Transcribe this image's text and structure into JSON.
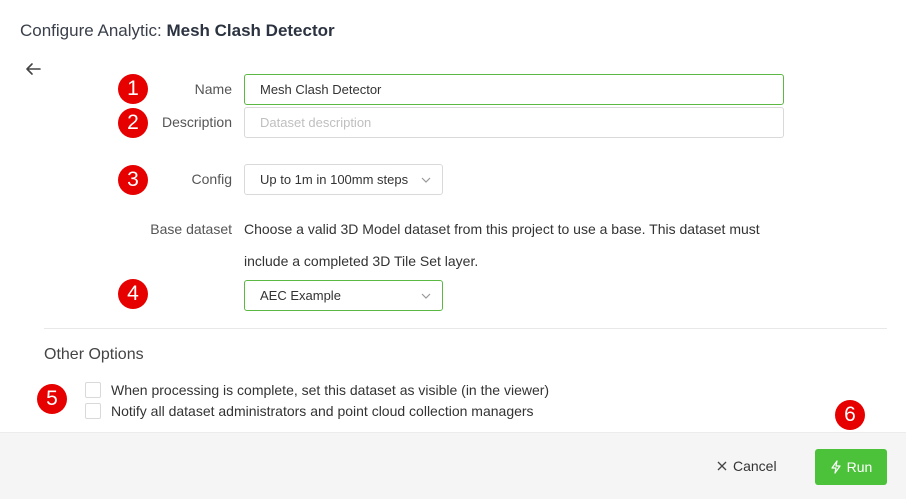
{
  "header": {
    "title_prefix": "Configure Analytic: ",
    "title_name": "Mesh Clash Detector"
  },
  "badges": [
    "1",
    "2",
    "3",
    "4",
    "5",
    "6"
  ],
  "form": {
    "name_label": "Name",
    "name_value": "Mesh Clash Detector",
    "description_label": "Description",
    "description_placeholder": "Dataset description",
    "config_label": "Config",
    "config_value": "Up to 1m in 100mm steps",
    "base_label": "Base dataset",
    "base_help_line1": "Choose a valid 3D Model dataset from this project to use a base. This dataset must",
    "base_help_line2": "include a completed 3D Tile Set layer.",
    "base_value": "AEC Example"
  },
  "other_options": {
    "title": "Other Options",
    "visible_label": "When processing is complete, set this dataset as visible (in the viewer)",
    "notify_label": "Notify all dataset administrators and point cloud collection managers"
  },
  "footer": {
    "cancel_label": "Cancel",
    "run_label": "Run"
  },
  "colors": {
    "badge": "#e60000",
    "accent": "#5bb843",
    "run_button": "#4cc23a"
  }
}
